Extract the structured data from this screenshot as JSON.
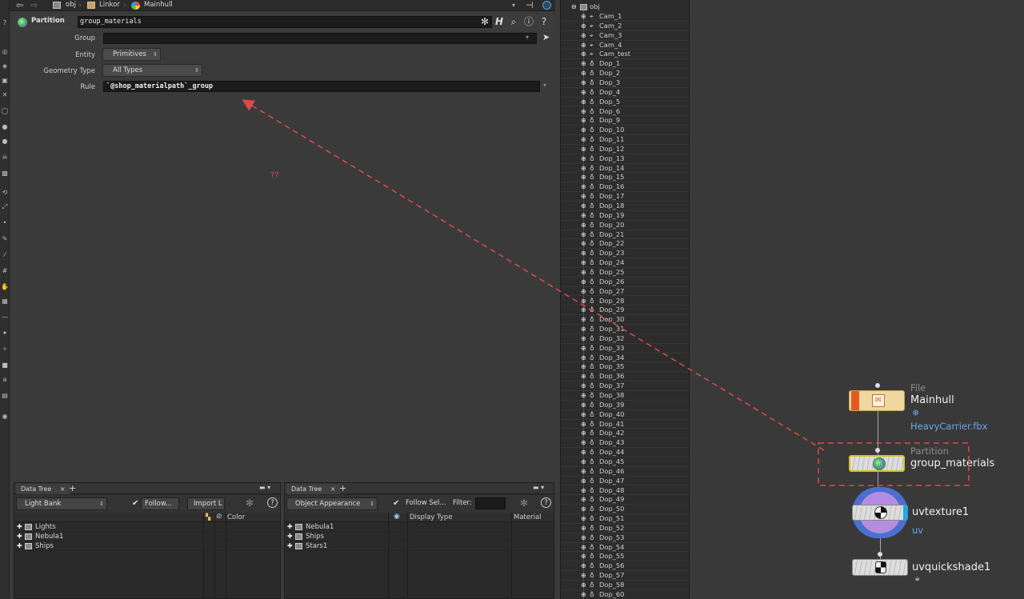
{
  "path_bar": {
    "crumbs": [
      "obj",
      "Linkor",
      "Mainhull"
    ]
  },
  "parameters": {
    "node_type": "Partition",
    "node_name": "group_materials",
    "group_label": "Group",
    "group_value": "",
    "entity_label": "Entity",
    "entity_value": "Primitives",
    "geometry_type_label": "Geometry Type",
    "geometry_type_value": "All Types",
    "rule_label": "Rule",
    "rule_value": "`@shop_materialpath`_group"
  },
  "annotation": {
    "question_text": "??",
    "arrow_color": "#e04848"
  },
  "data_tree_left": {
    "tab_label": "Data Tree",
    "tab_close": "×",
    "tab_add": "+",
    "combo_value": "Light Bank",
    "follow_label": "Follow...",
    "import_label": "Import L",
    "help_label": "?",
    "columns": [
      "Color"
    ],
    "rows": [
      "Lights",
      "Nebula1",
      "Ships"
    ]
  },
  "data_tree_right": {
    "tab_label": "Data Tree",
    "tab_close": "×",
    "tab_add": "+",
    "combo_value": "Object Appearance",
    "follow_label": "Follow Sel...",
    "filter_label": "Filter:",
    "help_label": "?",
    "columns": [
      "Display Type",
      "Material"
    ],
    "rows": [
      "Nebula1",
      "Ships",
      "Stars1"
    ]
  },
  "tree_view": {
    "root": "obj",
    "items": [
      {
        "label": "Cam_1",
        "kind": "cam"
      },
      {
        "label": "Cam_2",
        "kind": "cam"
      },
      {
        "label": "Cam_3",
        "kind": "cam"
      },
      {
        "label": "Cam_4",
        "kind": "cam"
      },
      {
        "label": "Cam_test",
        "kind": "cam"
      },
      {
        "label": "Dop_1",
        "kind": "dop"
      },
      {
        "label": "Dop_2",
        "kind": "dop"
      },
      {
        "label": "Dop_3",
        "kind": "dop"
      },
      {
        "label": "Dop_4",
        "kind": "dop"
      },
      {
        "label": "Dop_5",
        "kind": "dop"
      },
      {
        "label": "Dop_6",
        "kind": "dop"
      },
      {
        "label": "Dop_9",
        "kind": "dop"
      },
      {
        "label": "Dop_10",
        "kind": "dop"
      },
      {
        "label": "Dop_11",
        "kind": "dop"
      },
      {
        "label": "Dop_12",
        "kind": "dop"
      },
      {
        "label": "Dop_13",
        "kind": "dop"
      },
      {
        "label": "Dop_14",
        "kind": "dop"
      },
      {
        "label": "Dop_15",
        "kind": "dop"
      },
      {
        "label": "Dop_16",
        "kind": "dop"
      },
      {
        "label": "Dop_17",
        "kind": "dop"
      },
      {
        "label": "Dop_18",
        "kind": "dop"
      },
      {
        "label": "Dop_19",
        "kind": "dop"
      },
      {
        "label": "Dop_20",
        "kind": "dop"
      },
      {
        "label": "Dop_21",
        "kind": "dop"
      },
      {
        "label": "Dop_22",
        "kind": "dop"
      },
      {
        "label": "Dop_23",
        "kind": "dop"
      },
      {
        "label": "Dop_24",
        "kind": "dop"
      },
      {
        "label": "Dop_25",
        "kind": "dop"
      },
      {
        "label": "Dop_26",
        "kind": "dop"
      },
      {
        "label": "Dop_27",
        "kind": "dop"
      },
      {
        "label": "Dop_28",
        "kind": "dop"
      },
      {
        "label": "Dop_29",
        "kind": "dop"
      },
      {
        "label": "Dop_30",
        "kind": "dop"
      },
      {
        "label": "Dop_31",
        "kind": "dop"
      },
      {
        "label": "Dop_32",
        "kind": "dop"
      },
      {
        "label": "Dop_33",
        "kind": "dop"
      },
      {
        "label": "Dop_34",
        "kind": "dop"
      },
      {
        "label": "Dop_35",
        "kind": "dop"
      },
      {
        "label": "Dop_36",
        "kind": "dop"
      },
      {
        "label": "Dop_37",
        "kind": "dop"
      },
      {
        "label": "Dop_38",
        "kind": "dop"
      },
      {
        "label": "Dop_39",
        "kind": "dop"
      },
      {
        "label": "Dop_40",
        "kind": "dop"
      },
      {
        "label": "Dop_41",
        "kind": "dop"
      },
      {
        "label": "Dop_42",
        "kind": "dop"
      },
      {
        "label": "Dop_43",
        "kind": "dop"
      },
      {
        "label": "Dop_44",
        "kind": "dop"
      },
      {
        "label": "Dop_45",
        "kind": "dop"
      },
      {
        "label": "Dop_46",
        "kind": "dop"
      },
      {
        "label": "Dop_47",
        "kind": "dop"
      },
      {
        "label": "Dop_48",
        "kind": "dop"
      },
      {
        "label": "Dop_49",
        "kind": "dop"
      },
      {
        "label": "Dop_50",
        "kind": "dop"
      },
      {
        "label": "Dop_51",
        "kind": "dop"
      },
      {
        "label": "Dop_52",
        "kind": "dop"
      },
      {
        "label": "Dop_53",
        "kind": "dop"
      },
      {
        "label": "Dop_54",
        "kind": "dop"
      },
      {
        "label": "Dop_55",
        "kind": "dop"
      },
      {
        "label": "Dop_56",
        "kind": "dop"
      },
      {
        "label": "Dop_57",
        "kind": "dop"
      },
      {
        "label": "Dop_58",
        "kind": "dop"
      },
      {
        "label": "Dop_60",
        "kind": "dop"
      }
    ]
  },
  "network": {
    "file_node": {
      "type": "File",
      "name": "Mainhull",
      "sub": "HeavyCarrier.fbx"
    },
    "partition_node": {
      "type": "Partition",
      "name": "group_materials"
    },
    "uvtexture_node": {
      "name": "uvtexture1",
      "sub": "uv"
    },
    "uvquickshade_node": {
      "name": "uvquickshade1"
    },
    "accent_color": "#d6c02a"
  }
}
